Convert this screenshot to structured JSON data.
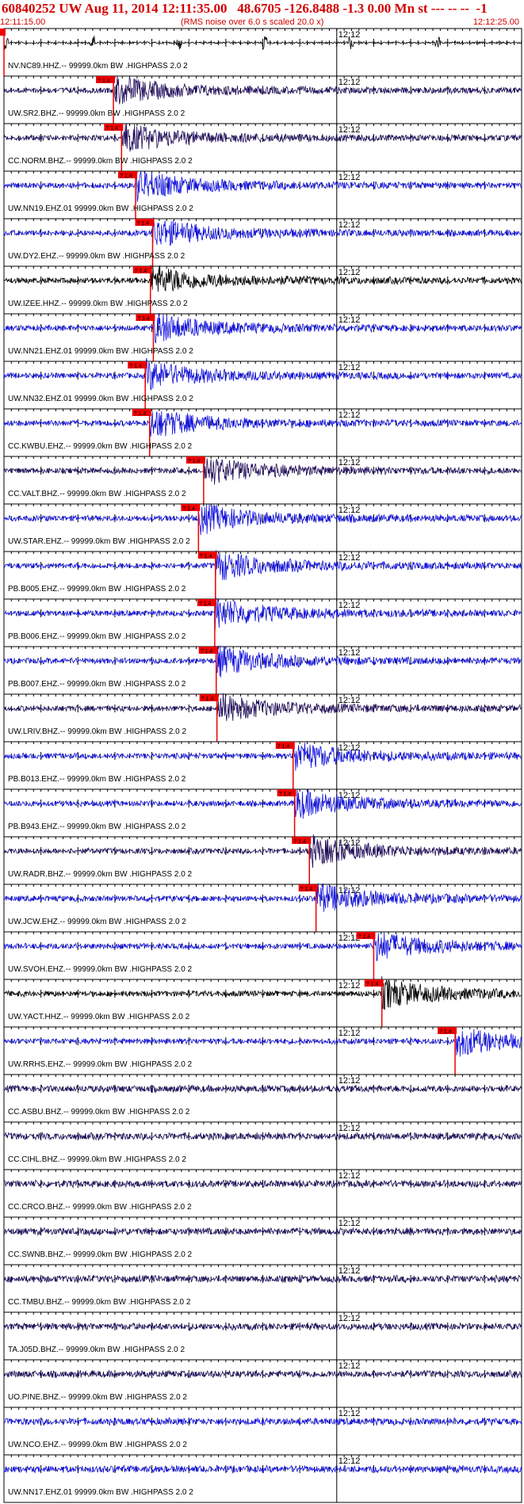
{
  "header": {
    "title": "60840252 UW Aug 11, 2014 12:11:35.00   48.6705 -126.8488 -1.3 0.00 Mn st --- -- --  -1",
    "time_start": "12:11:15.00",
    "rms_note": "(RMS noise over 6.0 s scaled 20.0 x)",
    "time_end": "12:12:25.00"
  },
  "colors": {
    "frame": "#000000",
    "header_text": "#d40000",
    "pick": "#ee0000",
    "trace_black": "#000000",
    "trace_navy": "#1c0a5a",
    "trace_blue": "#1010e0"
  },
  "chart_data": {
    "type": "line",
    "title": "60840252 UW Aug 11, 2014 12:11:35.00   48.6705 -126.8488 -1.3 0.00 Mn st --- -- --  -1",
    "x_range": [
      "12:11:15.00",
      "12:12:25.00"
    ],
    "minute_marker": "12:12",
    "pick_label": "? 1.4",
    "series": [
      {
        "name": "NV.NC89.HHZ.--",
        "label": "NV.NC89.HHZ.-- 99999.0km BW .HIGHPASS  2.0  2",
        "color": "black",
        "pick_time_s": 0.0
      },
      {
        "name": "UW.SR2.BHZ.--",
        "label": "UW.SR2.BHZ.-- 99999.0km BW .HIGHPASS  2.0  2",
        "color": "navy",
        "pick_time_s": 14.8
      },
      {
        "name": "CC.NORM.BHZ.--",
        "label": "CC.NORM.BHZ.-- 99999.0km BW .HIGHPASS  2.0  2",
        "color": "navy",
        "pick_time_s": 15.9
      },
      {
        "name": "UW.NN19.EHZ.01",
        "label": "UW.NN19.EHZ.01 99999.0km BW .HIGHPASS  2.0  2",
        "color": "blue",
        "pick_time_s": 17.8
      },
      {
        "name": "UW.DY2.EHZ.--",
        "label": "UW.DY2.EHZ.-- 99999.0km BW .HIGHPASS  2.0  2",
        "color": "blue",
        "pick_time_s": 20.1
      },
      {
        "name": "UW.IZEE.HHZ.--",
        "label": "UW.IZEE.HHZ.-- 99999.0km BW .HIGHPASS  2.0  2",
        "color": "black",
        "pick_time_s": 19.8
      },
      {
        "name": "UW.NN21.EHZ.01",
        "label": "UW.NN21.EHZ.01 99999.0km BW .HIGHPASS  2.0  2",
        "color": "blue",
        "pick_time_s": 20.2
      },
      {
        "name": "UW.NN32.EHZ.01",
        "label": "UW.NN32.EHZ.01 99999.0km BW .HIGHPASS  2.0  2",
        "color": "blue",
        "pick_time_s": 19.1
      },
      {
        "name": "CC.KWBU.EHZ.--",
        "label": "CC.KWBU.EHZ.-- 99999.0km BW .HIGHPASS  2.0  2",
        "color": "blue",
        "pick_time_s": 19.7
      },
      {
        "name": "CC.VALT.BHZ.--",
        "label": "CC.VALT.BHZ.-- 99999.0km BW .HIGHPASS  2.0  2",
        "color": "navy",
        "pick_time_s": 27.0
      },
      {
        "name": "UW.STAR.EHZ.--",
        "label": "UW.STAR.EHZ.-- 99999.0km BW .HIGHPASS  2.0  2",
        "color": "blue",
        "pick_time_s": 26.3
      },
      {
        "name": "PB.B005.EHZ.--",
        "label": "PB.B005.EHZ.-- 99999.0km BW .HIGHPASS  2.0  2",
        "color": "blue",
        "pick_time_s": 28.6
      },
      {
        "name": "PB.B006.EHZ.--",
        "label": "PB.B006.EHZ.-- 99999.0km BW .HIGHPASS  2.0  2",
        "color": "blue",
        "pick_time_s": 28.5
      },
      {
        "name": "PB.B007.EHZ.--",
        "label": "PB.B007.EHZ.-- 99999.0km BW .HIGHPASS  2.0  2",
        "color": "blue",
        "pick_time_s": 28.7
      },
      {
        "name": "UW.LRIV.BHZ.--",
        "label": "UW.LRIV.BHZ.-- 99999.0km BW .HIGHPASS  2.0  2",
        "color": "navy",
        "pick_time_s": 28.8
      },
      {
        "name": "PB.B013.EHZ.--",
        "label": "PB.B013.EHZ.-- 99999.0km BW .HIGHPASS  2.0  2",
        "color": "blue",
        "pick_time_s": 39.1
      },
      {
        "name": "PB.B943.EHZ.--",
        "label": "PB.B943.EHZ.-- 99999.0km BW .HIGHPASS  2.0  2",
        "color": "blue",
        "pick_time_s": 39.3
      },
      {
        "name": "UW.RADR.BHZ.--",
        "label": "UW.RADR.BHZ.-- 99999.0km BW .HIGHPASS  2.0  2",
        "color": "navy",
        "pick_time_s": 41.3
      },
      {
        "name": "UW.JCW.EHZ.--",
        "label": "UW.JCW.EHZ.-- 99999.0km BW .HIGHPASS  2.0  2",
        "color": "blue",
        "pick_time_s": 42.2
      },
      {
        "name": "UW.SVOH.EHZ.--",
        "label": "UW.SVOH.EHZ.-- 99999.0km BW .HIGHPASS  2.0  2",
        "color": "blue",
        "pick_time_s": 50.0
      },
      {
        "name": "UW.YACT.HHZ.--",
        "label": "UW.YACT.HHZ.-- 99999.0km BW .HIGHPASS  2.0  2",
        "color": "black",
        "pick_time_s": 51.1
      },
      {
        "name": "UW.RRHS.EHZ.--",
        "label": "UW.RRHS.EHZ.-- 99999.0km BW .HIGHPASS  2.0  2",
        "color": "blue",
        "pick_time_s": 61.0
      },
      {
        "name": "CC.ASBU.BHZ.--",
        "label": "CC.ASBU.BHZ.-- 99999.0km BW .HIGHPASS  2.0  2",
        "color": "navy",
        "pick_time_s": null
      },
      {
        "name": "CC.CIHL.BHZ.--",
        "label": "CC.CIHL.BHZ.-- 99999.0km BW .HIGHPASS  2.0  2",
        "color": "navy",
        "pick_time_s": null
      },
      {
        "name": "CC.CRCO.BHZ.--",
        "label": "CC.CRCO.BHZ.-- 99999.0km BW .HIGHPASS  2.0  2",
        "color": "navy",
        "pick_time_s": null
      },
      {
        "name": "CC.SWNB.BHZ.--",
        "label": "CC.SWNB.BHZ.-- 99999.0km BW .HIGHPASS  2.0  2",
        "color": "navy",
        "pick_time_s": null
      },
      {
        "name": "CC.TMBU.BHZ.--",
        "label": "CC.TMBU.BHZ.-- 99999.0km BW .HIGHPASS  2.0  2",
        "color": "navy",
        "pick_time_s": null
      },
      {
        "name": "TA.J05D.BHZ.--",
        "label": "TA.J05D.BHZ.-- 99999.0km BW .HIGHPASS  2.0  2",
        "color": "navy",
        "pick_time_s": null
      },
      {
        "name": "UO.PINE.BHZ.--",
        "label": "UO.PINE.BHZ.-- 99999.0km BW .HIGHPASS  2.0  2",
        "color": "navy",
        "pick_time_s": null
      },
      {
        "name": "UW.NCO.EHZ.--",
        "label": "UW.NCO.EHZ.-- 99999.0km BW .HIGHPASS  2.0  2",
        "color": "blue",
        "pick_time_s": null
      },
      {
        "name": "UW.NN17.EHZ.01",
        "label": "UW.NN17.EHZ.01 99999.0km BW .HIGHPASS  2.0  2",
        "color": "blue",
        "pick_time_s": null
      }
    ]
  }
}
